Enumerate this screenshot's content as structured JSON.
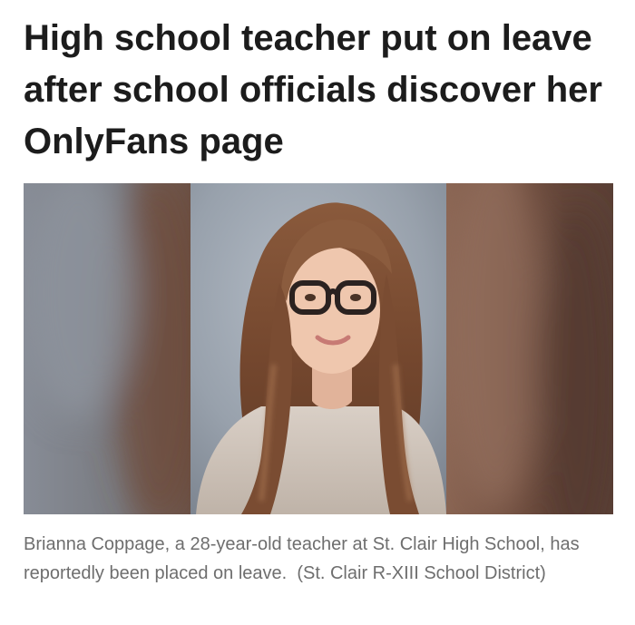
{
  "article": {
    "headline": "High school teacher put on leave after school officials discover her OnlyFans page",
    "photo": {
      "subject": "portrait-photo"
    },
    "caption": "Brianna Coppage, a 28-year-old teacher at St. Clair High School, has reportedly been placed on leave.  (St. Clair R-XIII School District)"
  },
  "colors": {
    "headline_text": "#1c1c1c",
    "caption_text": "#6e6e6e",
    "backdrop_left": "#7d828b",
    "backdrop_right": "#7a5a4c",
    "portrait_backdrop": "#9aa3ad"
  }
}
